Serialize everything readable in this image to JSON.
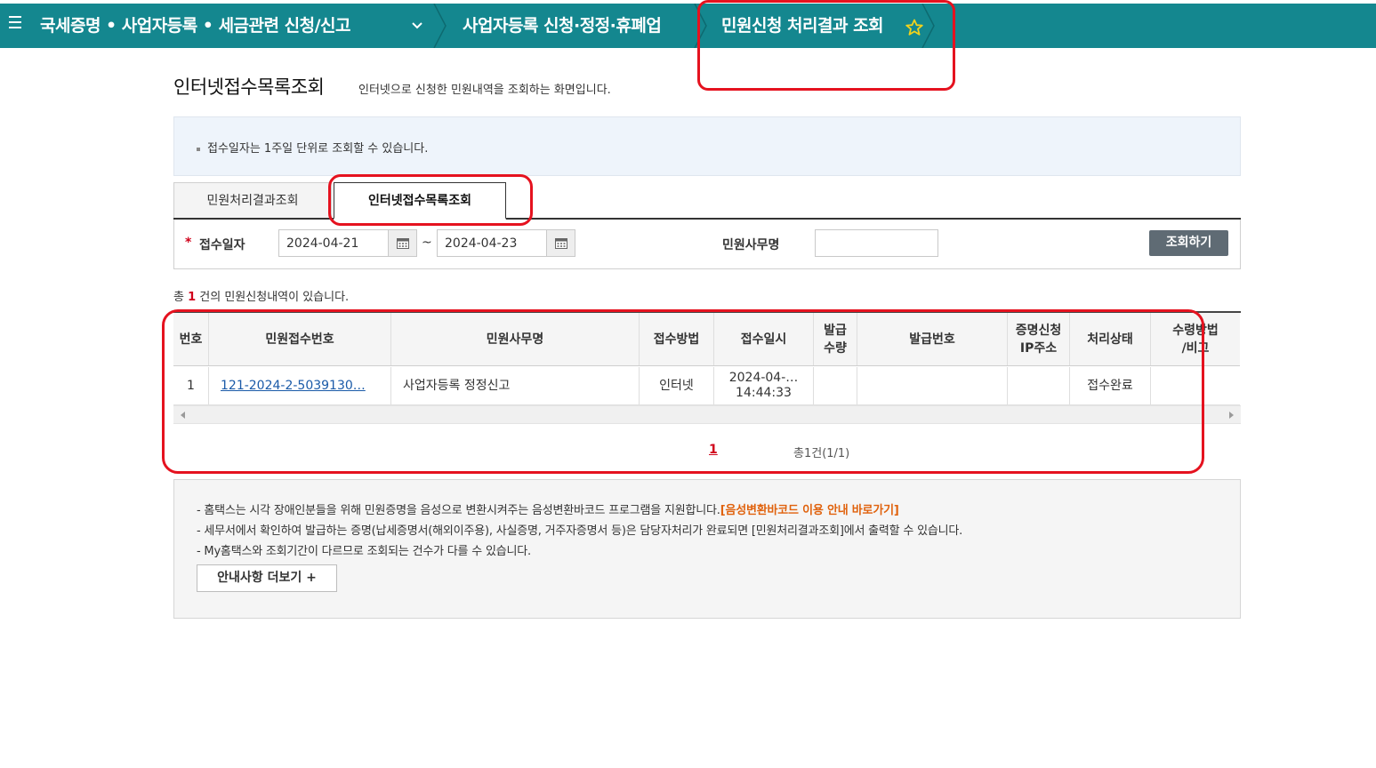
{
  "topnav": {
    "crumb1": "국세증명 • 사업자등록 • 세금관련 신청/신고",
    "crumb2": "사업자등록 신청·정정·휴폐업",
    "crumb3": "민원신청 처리결과 조회",
    "bg_color": "#14878f"
  },
  "page": {
    "title": "인터넷접수목록조회",
    "desc": "인터넷으로 신청한 민원내역을 조회하는 화면입니다."
  },
  "notice": {
    "text": "접수일자는 1주일 단위로 조회할 수 있습니다."
  },
  "tabs": [
    {
      "label": "민원처리결과조회",
      "active": false
    },
    {
      "label": "인터넷접수목록조회",
      "active": true
    }
  ],
  "search": {
    "required_mark": "*",
    "date_label": "접수일자",
    "start_date": "2024-04-21",
    "end_date": "2024-04-23",
    "tilde": "~",
    "office_label": "민원사무명",
    "office_value": "",
    "button_label": "조회하기"
  },
  "total": {
    "prefix": "총",
    "count": "1",
    "suffix": "건의 민원신청내역이 있습니다."
  },
  "table": {
    "headers": [
      "번호",
      "민원접수번호",
      "민원사무명",
      "접수방법",
      "접수일시",
      "발급\n수량",
      "발급번호",
      "증명신청\nIP주소",
      "처리상태",
      "수령방법\n/비고"
    ],
    "rows": [
      {
        "no": "1",
        "receipt_no": "121-2024-2-5039130…",
        "office_name": "사업자등록 정정신고",
        "method": "인터넷",
        "date_line1": "2024-04-…",
        "date_line2": "14:44:33",
        "qty": "",
        "issue_no": "",
        "ip": "",
        "status": "접수완료",
        "remark": ""
      }
    ]
  },
  "pager": {
    "current": "1",
    "summary": "총1건(1/1)"
  },
  "info": {
    "line1_text": "- 홈택스는 시각 장애인분들을 위해 민원증명을 음성으로 변환시켜주는 음성변환바코드 프로그램을 지원합니다.",
    "line1_link": "[음성변환바코드 이용 안내 바로가기]",
    "line2": "- 세무서에서 확인하여 발급하는 증명(납세증명서(해외이주용), 사실증명, 거주자증명서 등)은 담당자처리가 완료되면 [민원처리결과조회]에서 출력할 수 있습니다.",
    "line3": "- My홈택스와 조회기간이 다르므로 조회되는 건수가 다를 수 있습니다.",
    "more_button": "안내사항 더보기 +"
  }
}
